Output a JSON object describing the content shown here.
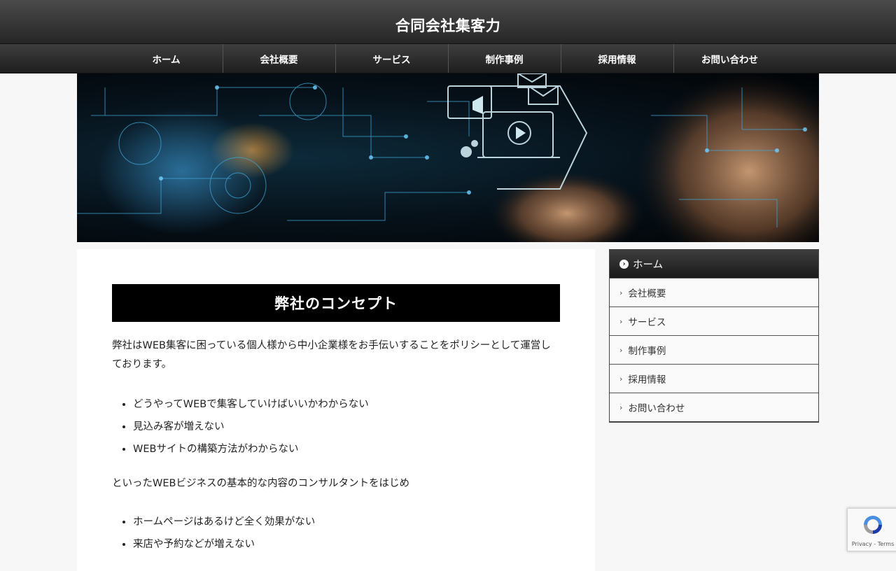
{
  "header": {
    "title": "合同会社集客力"
  },
  "nav": {
    "items": [
      {
        "label": "ホーム"
      },
      {
        "label": "会社概要"
      },
      {
        "label": "サービス"
      },
      {
        "label": "制作事例"
      },
      {
        "label": "採用情報"
      },
      {
        "label": "お問い合わせ"
      }
    ]
  },
  "main": {
    "heading": "弊社のコンセプト",
    "intro": "弊社はWEB集客に困っている個人様から中小企業様をお手伝いすることをポリシーとして運営しております。",
    "list1": [
      "どうやってWEBで集客していけばいいかわからない",
      "見込み客が増えない",
      "WEBサイトの構築方法がわからない"
    ],
    "mid": "といったWEBビジネスの基本的な内容のコンサルタントをはじめ",
    "list2": [
      "ホームページはあるけど全く効果がない",
      "来店や予約などが増えない"
    ]
  },
  "sidebar": {
    "head": "ホーム",
    "items": [
      {
        "label": "会社概要"
      },
      {
        "label": "サービス"
      },
      {
        "label": "制作事例"
      },
      {
        "label": "採用情報"
      },
      {
        "label": "お問い合わせ"
      }
    ]
  },
  "recaptcha": {
    "terms": "Privacy - Terms"
  }
}
